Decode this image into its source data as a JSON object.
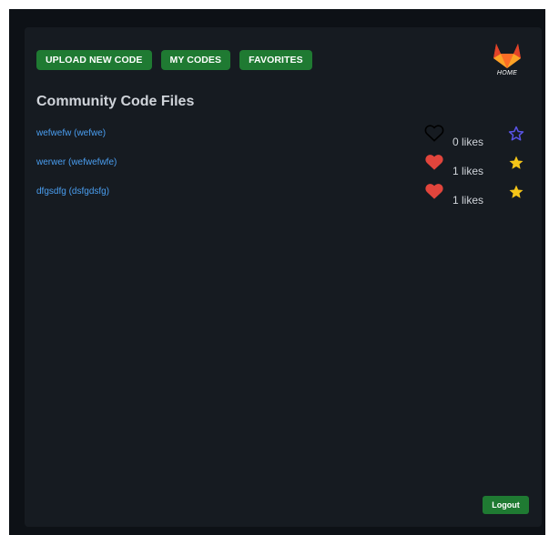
{
  "nav": {
    "upload_label": "UPLOAD NEW CODE",
    "my_codes_label": "MY CODES",
    "favorites_label": "FAVORITES"
  },
  "home": {
    "label": "HOME",
    "icon": "gitlab-fox-icon"
  },
  "page_title": "Community Code Files",
  "files": [
    {
      "name": "wefwefw (wefwe)",
      "likes": "0 likes",
      "liked": false,
      "favorited": false
    },
    {
      "name": "werwer (wefwefwfe)",
      "likes": "1 likes",
      "liked": true,
      "favorited": true
    },
    {
      "name": "dfgsdfg (dsfgdsfg)",
      "likes": "1 likes",
      "liked": true,
      "favorited": true
    }
  ],
  "logout_label": "Logout",
  "colors": {
    "background": "#0d1116",
    "panel": "#161b21",
    "button_green": "#1f7a32",
    "link_blue": "#4a9ef0",
    "heart_red": "#e2453c",
    "star_gold": "#f5c518",
    "star_outline": "#5a54e8"
  }
}
